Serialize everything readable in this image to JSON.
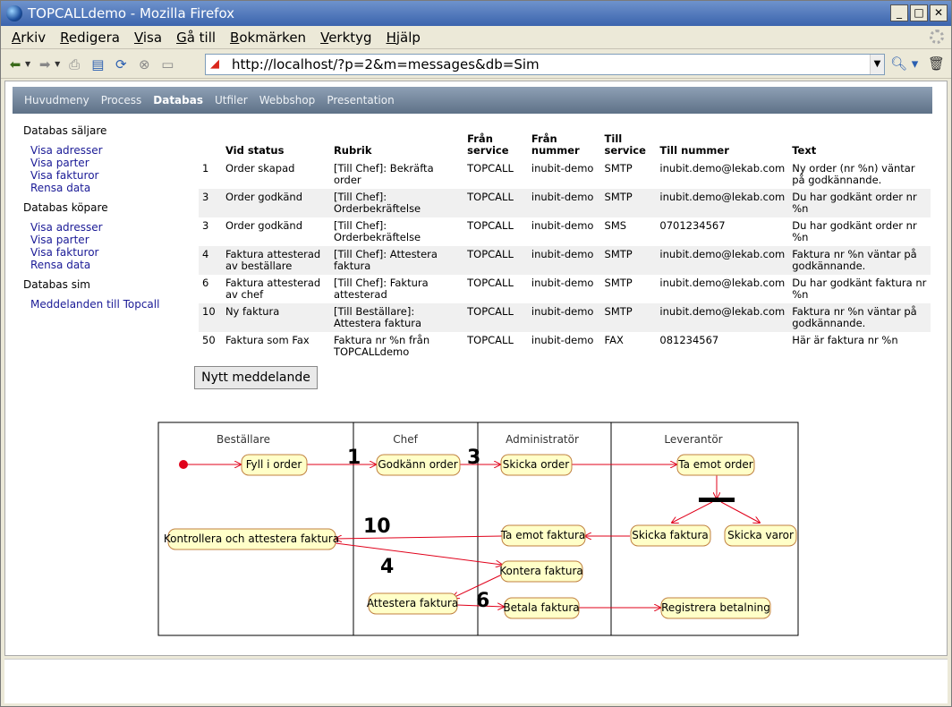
{
  "window": {
    "title": "TOPCALLdemo - Mozilla Firefox",
    "controls": [
      "_",
      "□",
      "✕"
    ]
  },
  "menubar": {
    "items": [
      "Arkiv",
      "Redigera",
      "Visa",
      "Gå till",
      "Bokmärken",
      "Verktyg",
      "Hjälp"
    ]
  },
  "navbar": {
    "url": "http://localhost/?p=2&m=messages&db=Sim",
    "icons": [
      "back-arrow-icon",
      "forward-arrow-icon",
      "print-icon",
      "page-info-icon",
      "reload-icon",
      "stop-icon",
      "fullscreen-icon",
      "search-icon",
      "trash-icon"
    ]
  },
  "sitenav": {
    "tabs": [
      {
        "label": "Huvudmeny",
        "active": false
      },
      {
        "label": "Process",
        "active": false
      },
      {
        "label": "Databas",
        "active": true
      },
      {
        "label": "Utfiler",
        "active": false
      },
      {
        "label": "Webbshop",
        "active": false
      },
      {
        "label": "Presentation",
        "active": false
      }
    ]
  },
  "sidebar": {
    "groups": [
      {
        "title": "Databas säljare",
        "links": [
          "Visa adresser",
          "Visa parter",
          "Visa fakturor",
          "Rensa data"
        ]
      },
      {
        "title": "Databas köpare",
        "links": [
          "Visa adresser",
          "Visa parter",
          "Visa fakturor",
          "Rensa data"
        ]
      },
      {
        "title": "Databas sim",
        "links": [
          "Meddelanden till Topcall"
        ]
      }
    ]
  },
  "table": {
    "headers": [
      "",
      "Vid status",
      "Rubrik",
      "Från service",
      "Från nummer",
      "Till service",
      "Till nummer",
      "Text"
    ],
    "rows": [
      [
        "1",
        "Order skapad",
        "[Till Chef]: Bekräfta order",
        "TOPCALL",
        "inubit-demo",
        "SMTP",
        "inubit.demo@lekab.com",
        "Ny order (nr %n) väntar på godkännande."
      ],
      [
        "3",
        "Order godkänd",
        "[Till Chef]: Orderbekräftelse",
        "TOPCALL",
        "inubit-demo",
        "SMTP",
        "inubit.demo@lekab.com",
        "Du har godkänt order nr %n"
      ],
      [
        "3",
        "Order godkänd",
        "[Till Chef]: Orderbekräftelse",
        "TOPCALL",
        "inubit-demo",
        "SMS",
        "0701234567",
        "Du har godkänt order nr %n"
      ],
      [
        "4",
        "Faktura attesterad av beställare",
        "[Till Chef]: Attestera faktura",
        "TOPCALL",
        "inubit-demo",
        "SMTP",
        "inubit.demo@lekab.com",
        "Faktura nr %n väntar på godkännande."
      ],
      [
        "6",
        "Faktura attesterad av chef",
        "[Till Chef]: Faktura attesterad",
        "TOPCALL",
        "inubit-demo",
        "SMTP",
        "inubit.demo@lekab.com",
        "Du har godkänt faktura nr %n"
      ],
      [
        "10",
        "Ny faktura",
        "[Till Beställare]: Attestera faktura",
        "TOPCALL",
        "inubit-demo",
        "SMTP",
        "inubit.demo@lekab.com",
        "Faktura nr %n väntar på godkännande."
      ],
      [
        "50",
        "Faktura som Fax",
        "Faktura nr %n från TOPCALLdemo",
        "TOPCALL",
        "inubit-demo",
        "FAX",
        "081234567",
        "Här är faktura nr %n"
      ]
    ]
  },
  "new_button": {
    "label": "Nytt meddelande"
  },
  "diagram": {
    "lanes": [
      "Beställare",
      "Chef",
      "Administratör",
      "Leverantör"
    ],
    "activities": {
      "fyll": "Fyll i order",
      "godkann": "Godkänn order",
      "skicka_order": "Skicka order",
      "ta_emot_order": "Ta emot order",
      "skicka_faktura": "Skicka faktura",
      "skicka_varor": "Skicka varor",
      "ta_emot_faktura": "Ta emot faktura",
      "kontrollera": "Kontrollera och attestera faktura",
      "kontera": "Kontera faktura",
      "attestera": "Attestera faktura",
      "betala": "Betala faktura",
      "registrera": "Registrera betalning"
    },
    "step_numbers": {
      "s1": "1",
      "s3": "3",
      "s10": "10",
      "s4": "4",
      "s6": "6"
    },
    "colors": {
      "flow": "#e0001a",
      "activity_fill": "#ffffc8",
      "activity_stroke": "#c08040"
    }
  }
}
